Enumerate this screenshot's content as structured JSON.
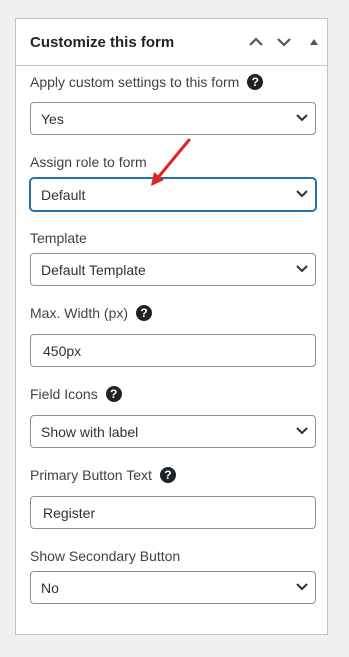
{
  "panel": {
    "title": "Customize this form",
    "icons": {
      "move_up": "chevron-up-icon",
      "move_down": "chevron-down-icon",
      "toggle": "triangle-up-icon"
    }
  },
  "fields": {
    "apply_custom": {
      "label": "Apply custom settings to this form",
      "value": "Yes",
      "help": "?"
    },
    "assign_role": {
      "label": "Assign role to form",
      "value": "Default"
    },
    "template": {
      "label": "Template",
      "value": "Default Template"
    },
    "max_width": {
      "label": "Max. Width (px)",
      "value": "450px",
      "help": "?"
    },
    "field_icons": {
      "label": "Field Icons",
      "value": "Show with label",
      "help": "?"
    },
    "primary_button_text": {
      "label": "Primary Button Text",
      "value": "Register",
      "help": "?"
    },
    "show_secondary": {
      "label": "Show Secondary Button",
      "value": "No"
    }
  },
  "colors": {
    "accent": "#2271b1",
    "annotation_arrow": "#e02424",
    "border": "#8c8f94"
  }
}
